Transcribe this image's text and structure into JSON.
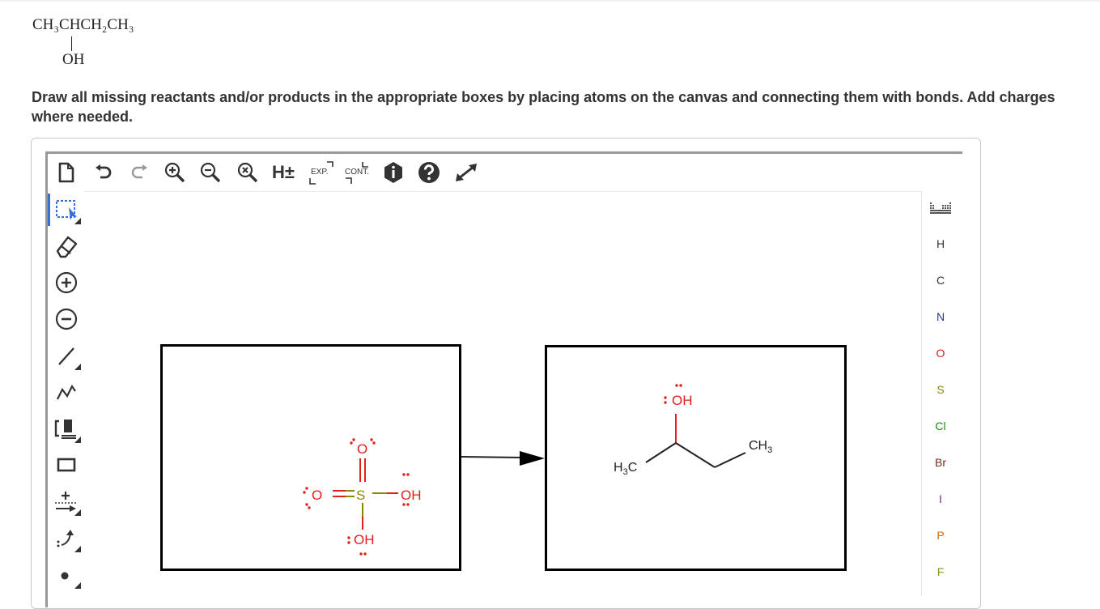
{
  "question": {
    "formula_main": "CH₃CHCH₂CH₃",
    "formula_oh": "OH",
    "instructions": "Draw all missing reactants and/or products in the appropriate boxes by placing atoms on the canvas and connecting them with bonds. Add charges where needed."
  },
  "toolbar": {
    "h_label": "H±",
    "exp_label": "EXP.",
    "cont_label": "CONT."
  },
  "left_tools": [
    "select",
    "erase",
    "charge-plus",
    "charge-minus",
    "single-bond",
    "chain",
    "template",
    "shape",
    "reaction-arrow",
    "curved-arrow",
    "electron-dot"
  ],
  "periodic": {
    "elements": [
      {
        "symbol": "H",
        "color": "#333333"
      },
      {
        "symbol": "C",
        "color": "#333333"
      },
      {
        "symbol": "N",
        "color": "#2e3192"
      },
      {
        "symbol": "O",
        "color": "#e0201b"
      },
      {
        "symbol": "S",
        "color": "#8a8a00"
      },
      {
        "symbol": "Cl",
        "color": "#1a8c1a"
      },
      {
        "symbol": "Br",
        "color": "#6e2f1a"
      },
      {
        "symbol": "I",
        "color": "#7a2a8a"
      },
      {
        "symbol": "P",
        "color": "#c8720a"
      },
      {
        "symbol": "F",
        "color": "#7a9a1a"
      }
    ]
  },
  "reactant": {
    "o_top": "O",
    "o_left": "O",
    "s": "S",
    "oh_right": "OH",
    "oh_bottom": "OH"
  },
  "product": {
    "oh": "OH",
    "ch3_left_main": "H",
    "ch3_left_sub": "3",
    "ch3_left_end": "C",
    "ch3_right_main": "CH",
    "ch3_right_sub": "3"
  },
  "colors": {
    "oxygen": "#e0201b",
    "sulfur": "#8a8a00",
    "selected": "#3b6fd8"
  }
}
